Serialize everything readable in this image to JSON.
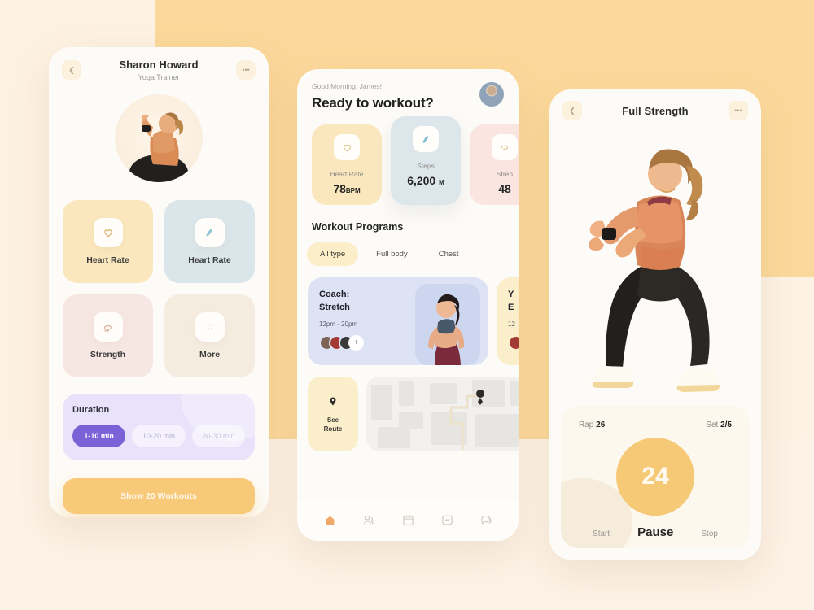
{
  "background": {
    "cream": "#fdf1e2",
    "orange": "#fbd89b",
    "bottom": "#fdf2e6"
  },
  "profile_screen": {
    "back_icon": "chevron-left-icon",
    "menu_icon": "ellipsis-icon",
    "title": "Sharon Howard",
    "subtitle": "Yoga Trainer",
    "avatar": "trainer-photo",
    "stat_cards": [
      {
        "label": "Heart Rate",
        "icon": "heart-icon",
        "color": "#fbe7bd"
      },
      {
        "label": "Heart Rate",
        "icon": "shoe-icon",
        "color": "#dbe6ea"
      },
      {
        "label": "Strength",
        "icon": "arm-icon",
        "color": "#f7e7e3"
      },
      {
        "label": "More",
        "icon": "dots-grid-icon",
        "color": "#f5ece0"
      }
    ],
    "duration": {
      "title": "Duration",
      "chips": [
        {
          "label": "1-10 min",
          "selected": true
        },
        {
          "label": "10-20 min",
          "selected": false
        },
        {
          "label": "20-30 min",
          "selected": false
        }
      ],
      "selected_color": "#7b62d6",
      "panel_color": "#e8e3fb"
    },
    "cta_label": "Show 20 Workouts",
    "cta_color": "#f7c979"
  },
  "home_screen": {
    "greeting": "Good Morning, James!",
    "headline": "Ready to workout?",
    "avatar": "user-avatar",
    "metrics": [
      {
        "name": "Heart Rate",
        "value": "78",
        "unit": "BPM",
        "icon": "heart-icon",
        "color": "#fbe7bd",
        "raised": false
      },
      {
        "name": "Steps",
        "value": "6,200",
        "unit": "M",
        "icon": "shoe-icon",
        "color": "#dde6ea",
        "raised": true
      },
      {
        "name": "Stren",
        "value": "48",
        "unit": "",
        "icon": "arm-icon",
        "color": "#fae5e0",
        "raised": false
      }
    ],
    "section_title": "Workout Programs",
    "filters": [
      {
        "label": "All type",
        "selected": true
      },
      {
        "label": "Full body",
        "selected": false
      },
      {
        "label": "Chest",
        "selected": false
      }
    ],
    "programs": [
      {
        "line1": "Coach:",
        "line2": "Stretch",
        "time": "12pm - 20pm",
        "add_label": "+",
        "color": "#dee2f5"
      },
      {
        "line1": "Y",
        "line2": "E",
        "time": "12",
        "add_label": "+",
        "color": "#fbeecb"
      }
    ],
    "route": {
      "icon": "location-pin-icon",
      "label_line1": "See",
      "label_line2": "Route",
      "map_pin_icon": "map-pin-icon"
    },
    "tabs": [
      {
        "name": "home-tab",
        "icon": "home-icon",
        "active": true
      },
      {
        "name": "people-tab",
        "icon": "people-icon",
        "active": false
      },
      {
        "name": "calendar-tab",
        "icon": "calendar-icon",
        "active": false
      },
      {
        "name": "activity-tab",
        "icon": "activity-icon",
        "active": false
      },
      {
        "name": "chat-tab",
        "icon": "chat-icon",
        "active": false
      }
    ],
    "active_tab_color": "#f0a868"
  },
  "workout_screen": {
    "back_icon": "chevron-left-icon",
    "menu_icon": "ellipsis-icon",
    "title": "Full Strength",
    "pose_image": "squat-pose-photo",
    "rap_label": "Rap",
    "rap_value": "26",
    "set_label": "Set",
    "set_value": "2/5",
    "timer_value": "24",
    "timer_color": "#f6c977",
    "controls": [
      {
        "label": "Start",
        "active": false
      },
      {
        "label": "Pause",
        "active": true
      },
      {
        "label": "Stop",
        "active": false
      }
    ]
  }
}
